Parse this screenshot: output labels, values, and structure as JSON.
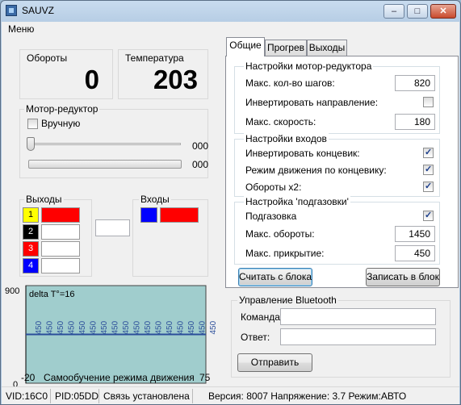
{
  "window": {
    "title": "SAUVZ",
    "minimize": "–",
    "maximize": "□",
    "close": "✕"
  },
  "menu": {
    "item": "Меню"
  },
  "gauges": {
    "rpm_label": "Обороты",
    "rpm_value": "0",
    "temp_label": "Температура",
    "temp_value": "203"
  },
  "motor": {
    "group": "Мотор-редуктор",
    "manual_label": "Вручную",
    "manual_checked": false,
    "slider1_value": "000",
    "slider2_value": "000",
    "slider1_level": 0
  },
  "outputs": {
    "group": "Выходы",
    "items": [
      {
        "num": "1",
        "color": "#ffff00",
        "num_color": "#000000",
        "indicator": "#ff0000"
      },
      {
        "num": "2",
        "color": "#000000",
        "num_color": "#ffffff",
        "indicator": "#ffffff"
      },
      {
        "num": "3",
        "color": "#ff0000",
        "num_color": "#ffffff",
        "indicator": "#ffffff"
      },
      {
        "num": "4",
        "color": "#0000ff",
        "num_color": "#ffffff",
        "indicator": "#ffffff"
      }
    ]
  },
  "inputs": {
    "group": "Входы",
    "items": [
      {
        "color": "#0000ff",
        "indicator": "#ff0000"
      }
    ]
  },
  "chart_data": {
    "type": "line",
    "annotation": "delta T°=16",
    "ylim": [
      0,
      900
    ],
    "xlim": [
      -20,
      75
    ],
    "ytick_labels": [
      "900",
      "0"
    ],
    "xtick_labels": [
      "-20",
      "75"
    ],
    "xlabel": "Самообучение режима движения",
    "series": [
      {
        "values_label": "450",
        "value": 450
      }
    ],
    "background": "#a0cdcd",
    "line_color": "#2b4e9a"
  },
  "tabs": [
    "Общие",
    "Прогрев",
    "Выходы"
  ],
  "settings": {
    "motor_group": "Настройки мотор-редуктора",
    "max_steps_label": "Макс. кол-во шагов:",
    "max_steps": "820",
    "invert_dir_label": "Инвертировать направление:",
    "invert_dir": false,
    "max_speed_label": "Макс. скорость:",
    "max_speed": "180",
    "inputs_group": "Настройки  входов",
    "invert_end_label": "Инвертировать концевик:",
    "invert_end": true,
    "end_mode_label": "Режим движения по концевику:",
    "end_mode": true,
    "rpm_x2_label": "Обороты x2:",
    "rpm_x2": true,
    "boost_group": "Настройка 'подгазовки'",
    "boost_label": "Подгазовка",
    "boost": true,
    "max_rpm_label": "Макс. обороты:",
    "max_rpm": "1450",
    "max_open_label": "Макс. прикрытие:",
    "max_open": "450",
    "read_button": "Считать с блока",
    "write_button": "Записать в блок"
  },
  "bluetooth": {
    "group": "Управление Bluetooth",
    "command_label": "Команда:",
    "command_value": "",
    "answer_label": "Ответ:",
    "answer_value": "",
    "send_button": "Отправить"
  },
  "status": {
    "vid": "VID:16C0",
    "pid": "PID:05DD",
    "connection": "Связь установлена",
    "version": "Версия: 8007 Напряжение: 3.7 Режим:АВТО"
  },
  "colors": {
    "accent_check": "#1c3e8a",
    "title_bar": "#b4cbe3"
  }
}
